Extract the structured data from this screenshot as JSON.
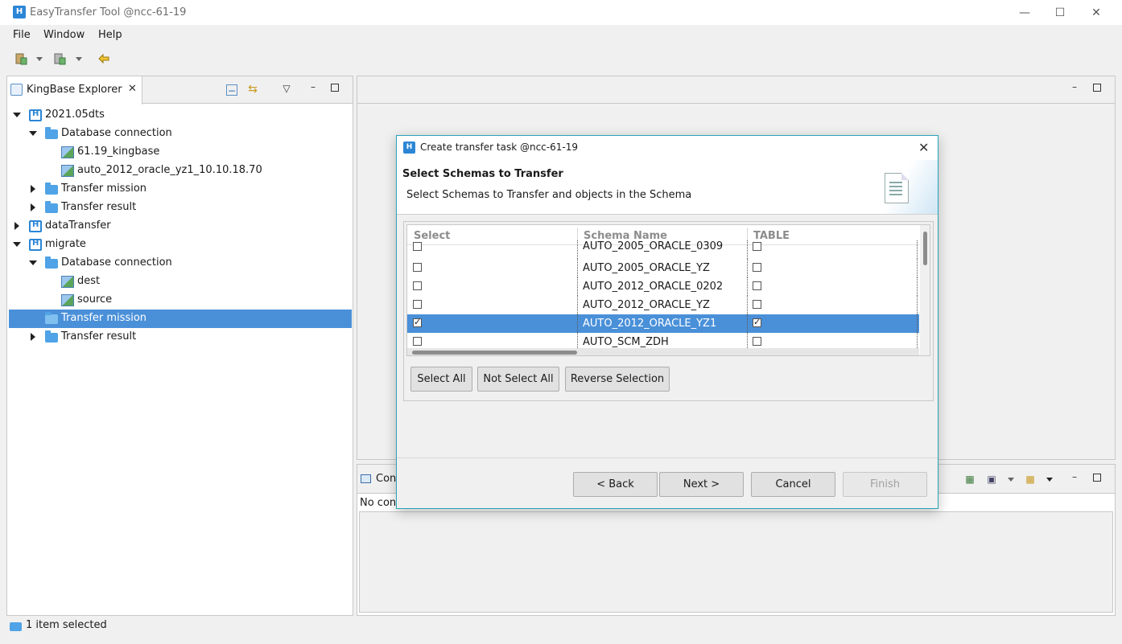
{
  "window": {
    "title": "EasyTransfer Tool @ncc-61-19"
  },
  "menu": {
    "items": [
      "File",
      "Window",
      "Help"
    ]
  },
  "explorer": {
    "tab_label": "KingBase Explorer",
    "tree": [
      {
        "label": "2021.05dts"
      },
      {
        "label": "Database connection"
      },
      {
        "label": "61.19_kingbase"
      },
      {
        "label": "auto_2012_oracle_yz1_10.10.18.70"
      },
      {
        "label": "Transfer mission"
      },
      {
        "label": "Transfer result"
      },
      {
        "label": "dataTransfer"
      },
      {
        "label": "migrate"
      },
      {
        "label": "Database connection"
      },
      {
        "label": "dest"
      },
      {
        "label": "source"
      },
      {
        "label": "Transfer mission"
      },
      {
        "label": "Transfer result"
      }
    ]
  },
  "console": {
    "tab_label": "Con",
    "text": "No con"
  },
  "status": {
    "text": "1 item selected"
  },
  "dialog": {
    "title": "Create transfer task @ncc-61-19",
    "heading": "Select Schemas to Transfer",
    "description": "Select Schemas to Transfer and objects in the Schema",
    "table": {
      "columns": [
        "Select",
        "Schema Name",
        "TABLE"
      ],
      "rows": [
        {
          "schema": "AUTO_2005_ORACLE_0309",
          "selected": false,
          "table": false
        },
        {
          "schema": "AUTO_2005_ORACLE_YZ",
          "selected": false,
          "table": false
        },
        {
          "schema": "AUTO_2012_ORACLE_0202",
          "selected": false,
          "table": false
        },
        {
          "schema": "AUTO_2012_ORACLE_YZ",
          "selected": false,
          "table": false
        },
        {
          "schema": "AUTO_2012_ORACLE_YZ1",
          "selected": true,
          "table": true
        },
        {
          "schema": "AUTO_SCM_ZDH",
          "selected": false,
          "table": false
        }
      ]
    },
    "buttons": {
      "select_all": "Select All",
      "not_select_all": "Not Select All",
      "reverse": "Reverse Selection",
      "back": "< Back",
      "next": "Next >",
      "cancel": "Cancel",
      "finish": "Finish"
    }
  }
}
